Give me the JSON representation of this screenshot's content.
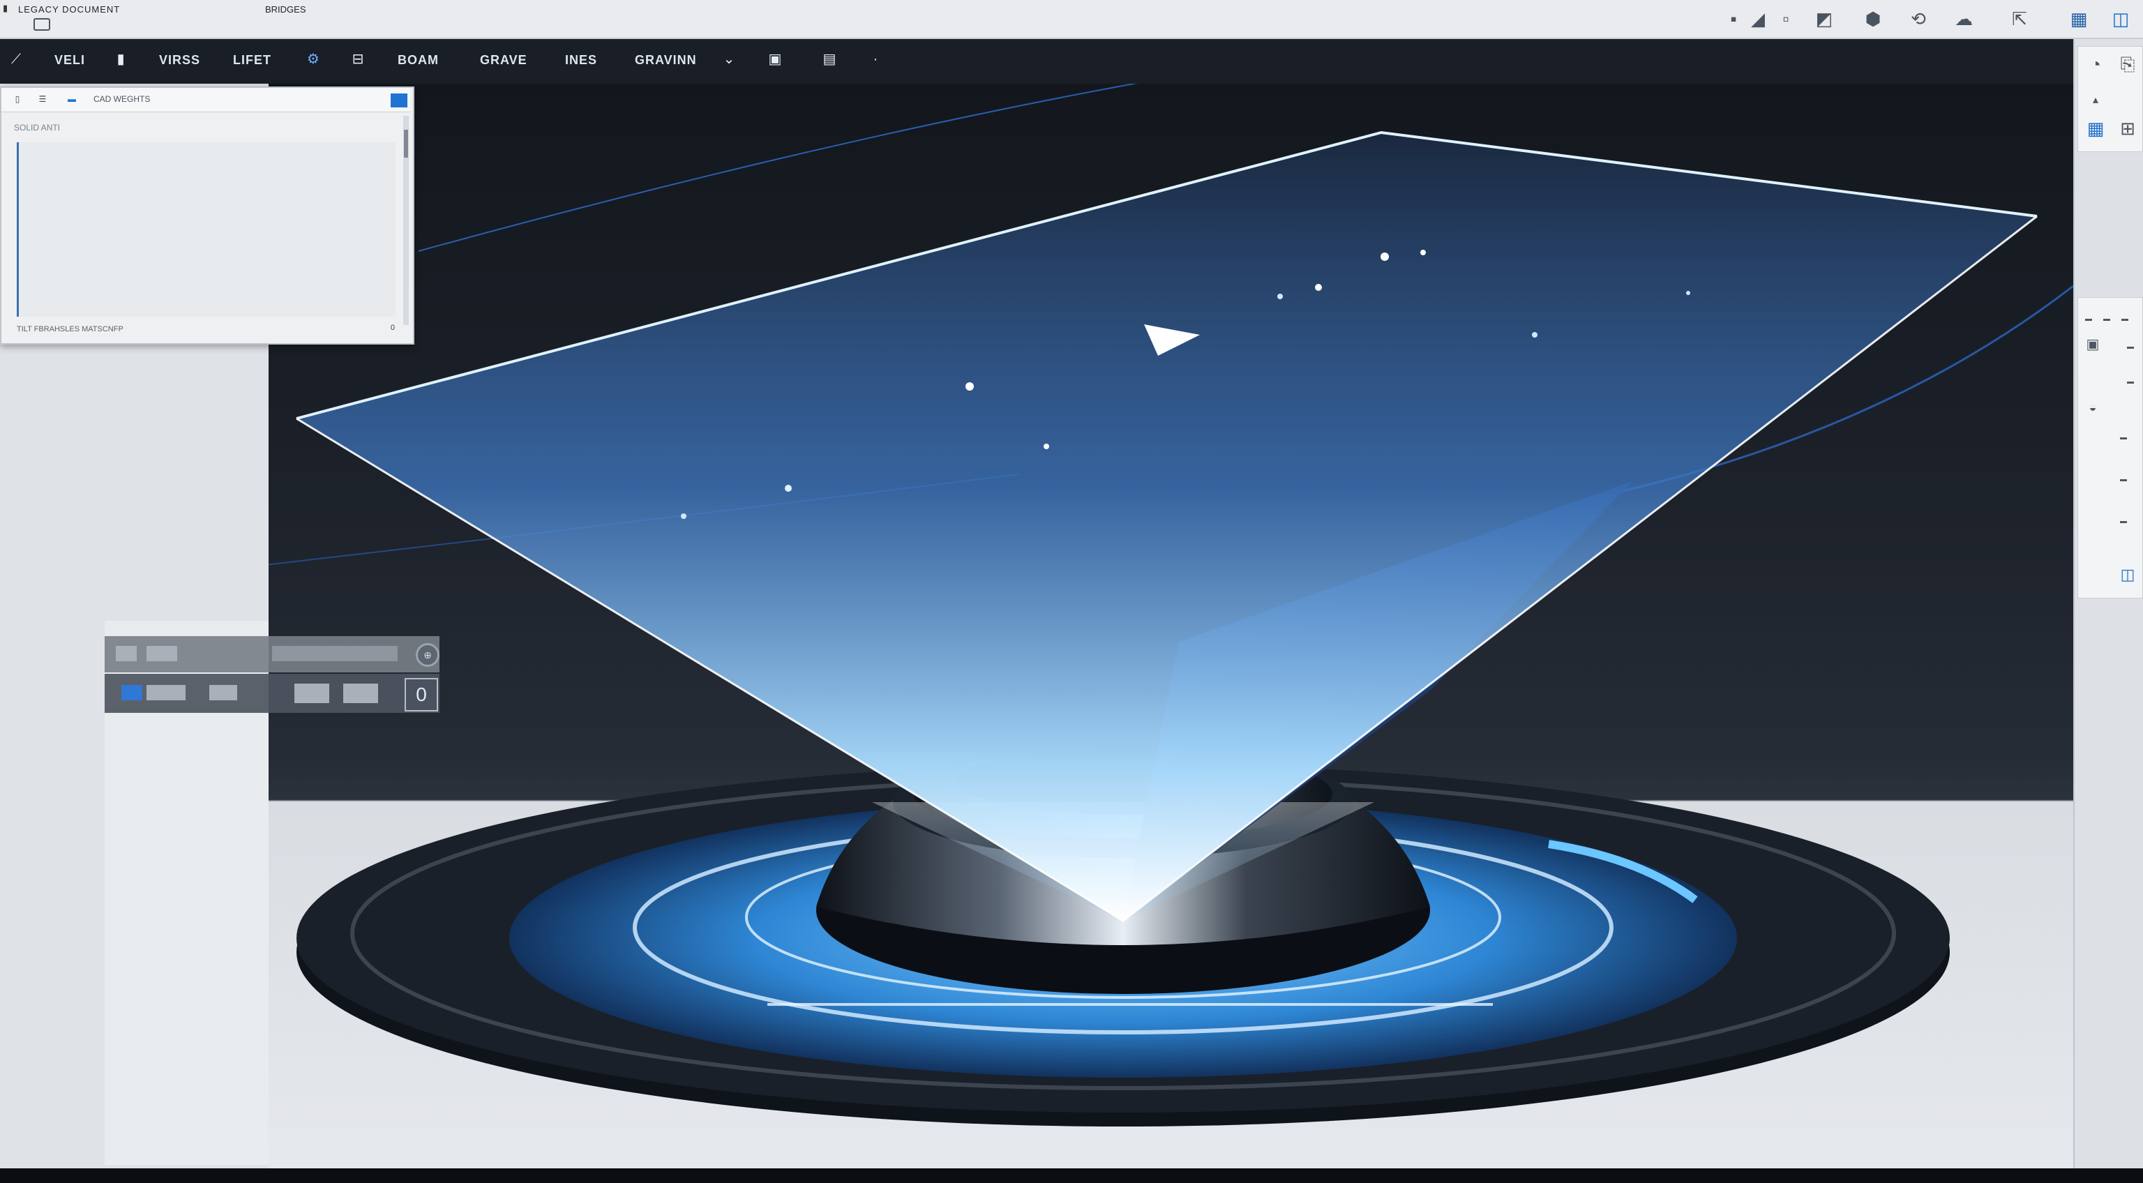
{
  "titlebar": {
    "brand": "LEGACY DOCUMENT",
    "sub": "BRIDGES",
    "icons": [
      "square-icon",
      "paint-icon",
      "document-icon",
      "cube-icon",
      "render-icon",
      "cloud-icon",
      "export-icon",
      "grid-icon",
      "panel-icon"
    ]
  },
  "menubar": {
    "items": [
      "VELI",
      "VIRSS",
      "LIFET",
      "BOAM",
      "GRAVE",
      "INES",
      "GRAVINN"
    ],
    "icons": [
      "select-tool-icon",
      "pin-icon",
      "gear-icon",
      "bookmark-icon",
      "chart-icon",
      "image-icon",
      "dot-icon"
    ]
  },
  "props_panel": {
    "title": "CAD WEGHTS",
    "sub_label": "SOLID ANTI",
    "footer": "TILT FBRAHSLES MATSCNFP",
    "footer_value": "0"
  },
  "viewport": {
    "frame_counter": "0",
    "zoom_label": "⊕"
  },
  "colors": {
    "accent": "#1f73d1",
    "hologram": "#6fc7ff",
    "dark_bg": "#161b22"
  }
}
